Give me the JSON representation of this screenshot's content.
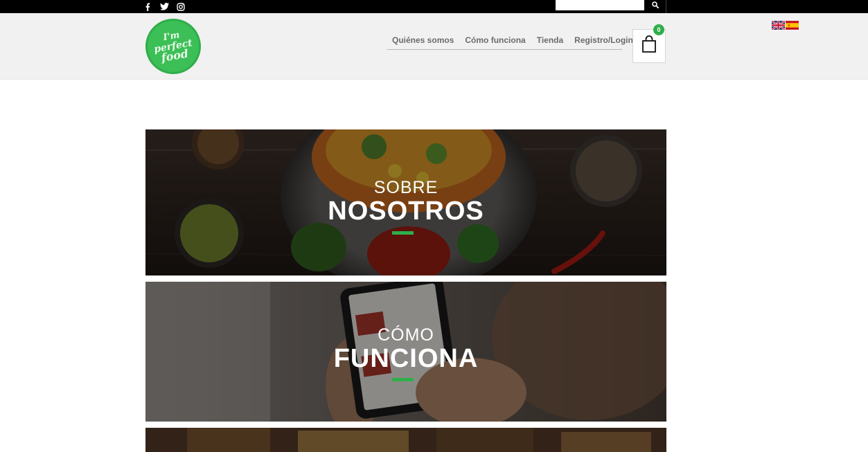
{
  "topbar": {
    "social": [
      {
        "icon": "facebook-icon"
      },
      {
        "icon": "twitter-icon"
      },
      {
        "icon": "instagram-icon"
      }
    ],
    "search": {
      "placeholder": "",
      "value": ""
    }
  },
  "header": {
    "logo": {
      "line1": "I'm",
      "line2": "perfect",
      "line3": "food"
    },
    "nav": [
      "Quiénes somos",
      "Cómo funciona",
      "Tienda",
      "Registro/Login"
    ],
    "cart": {
      "count": "0"
    },
    "languages": [
      "English",
      "Español"
    ]
  },
  "banners": [
    {
      "small": "SOBRE",
      "big": "NOSOTROS"
    },
    {
      "small": "CÓMO",
      "big": "FUNCIONA"
    }
  ],
  "colors": {
    "accent": "#2fae4a",
    "topbar": "#000000",
    "header": "#f1f1f1"
  }
}
